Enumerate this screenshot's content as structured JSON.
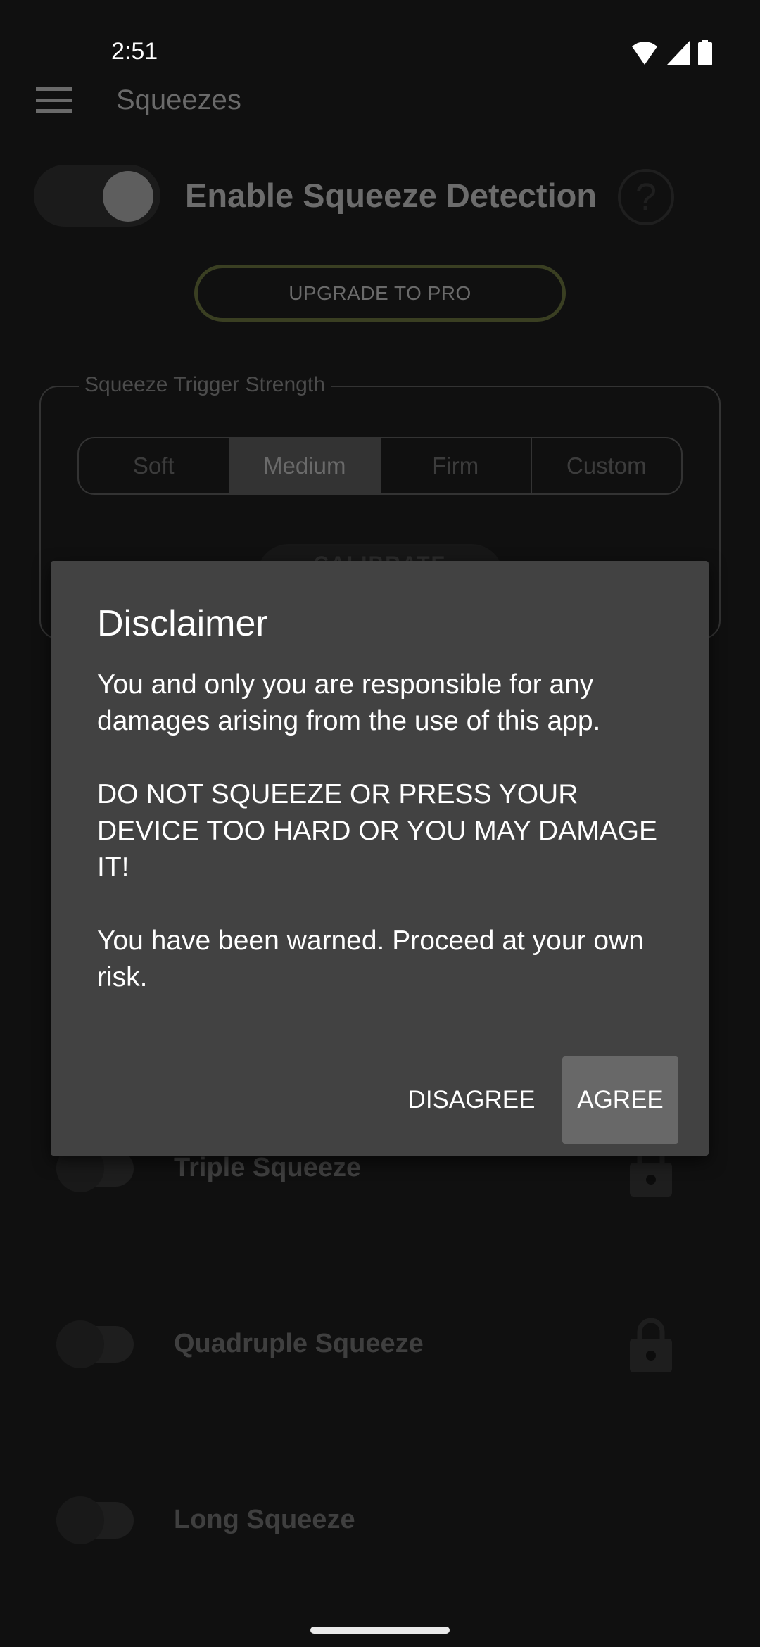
{
  "status_bar": {
    "time": "2:51",
    "icons": [
      "wifi-icon",
      "signal-icon",
      "battery-icon"
    ]
  },
  "app_bar": {
    "menu_icon": "hamburger-menu-icon",
    "title": "Squeezes"
  },
  "master_toggle": {
    "label": "Enable Squeeze Detection",
    "enabled": false,
    "help_icon": "help-circle-icon",
    "help_glyph": "?"
  },
  "upgrade_button": {
    "label": "UPGRADE TO PRO",
    "accent": "#3a3f22"
  },
  "trigger_strength": {
    "legend": "Squeeze Trigger Strength",
    "options": [
      {
        "label": "Soft",
        "selected": false
      },
      {
        "label": "Medium",
        "selected": true
      },
      {
        "label": "Firm",
        "selected": false
      },
      {
        "label": "Custom",
        "selected": false
      }
    ],
    "calibrate_label": "CALIBRATE"
  },
  "squeeze_rows": [
    {
      "label": "Triple Squeeze",
      "enabled": false,
      "locked": true
    },
    {
      "label": "Quadruple Squeeze",
      "enabled": false,
      "locked": true
    },
    {
      "label": "Long Squeeze",
      "enabled": false,
      "locked": false
    }
  ],
  "dialog": {
    "title": "Disclaimer",
    "paragraphs": [
      "You and only you are responsible for any damages arising from the use of this app.",
      "DO NOT SQUEEZE OR PRESS YOUR DEVICE TOO HARD OR YOU MAY DAMAGE IT!",
      "You have been warned. Proceed at your own risk."
    ],
    "disagree_label": "DISAGREE",
    "agree_label": "AGREE"
  }
}
